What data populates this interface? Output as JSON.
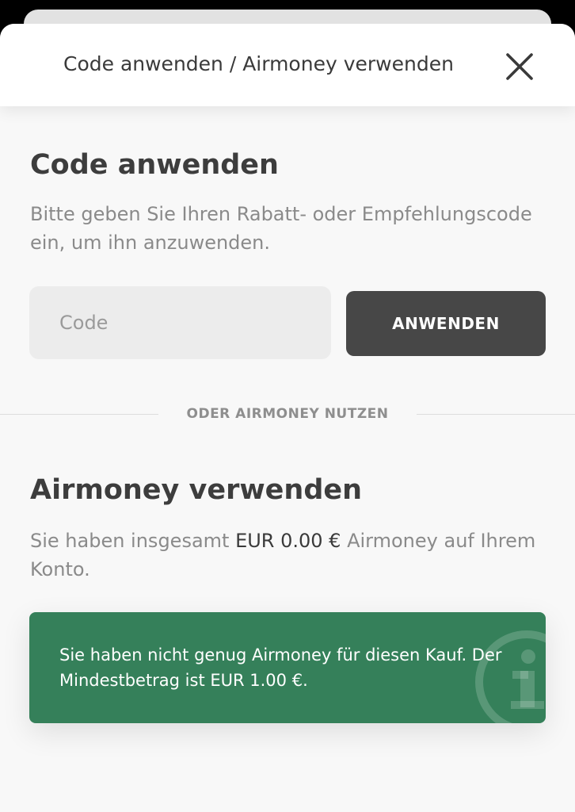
{
  "header": {
    "title": "Code anwenden / Airmoney verwenden",
    "close_icon": "close-icon"
  },
  "code_section": {
    "heading": "Code anwenden",
    "description": "Bitte geben Sie Ihren Rabatt- oder Empfehlungscode ein, um ihn anzuwenden.",
    "input_placeholder": "Code",
    "input_value": "",
    "apply_button_label": "ANWENDEN"
  },
  "divider": {
    "label": "ODER AIRMONEY NUTZEN"
  },
  "airmoney_section": {
    "heading": "Airmoney verwenden",
    "balance_prefix": "Sie haben insgesamt ",
    "balance_amount": "EUR 0.00 €",
    "balance_suffix": " Airmoney auf Ihrem Konto."
  },
  "notice": {
    "text": "Sie haben nicht genug Airmoney für diesen Kauf. Der Mindestbetrag ist EUR 1.00 €.",
    "icon": "info-icon",
    "color": "#35805a"
  },
  "colors": {
    "sheet_background": "#f8f8f8",
    "button_background": "#474747",
    "notice_background": "#35805a"
  }
}
